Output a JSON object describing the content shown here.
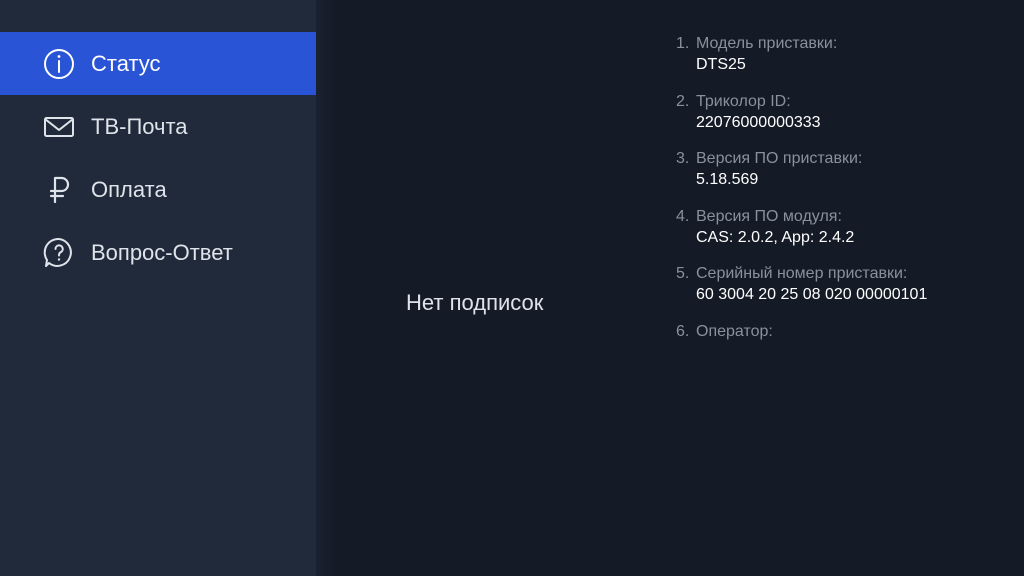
{
  "sidebar": {
    "items": [
      {
        "label": "Статус",
        "icon": "info-icon",
        "active": true
      },
      {
        "label": "ТВ-Почта",
        "icon": "mail-icon",
        "active": false
      },
      {
        "label": "Оплата",
        "icon": "ruble-icon",
        "active": false
      },
      {
        "label": "Вопрос-Ответ",
        "icon": "question-bubble-icon",
        "active": false
      }
    ]
  },
  "main": {
    "message": "Нет подписок"
  },
  "info": {
    "items": [
      {
        "num": "1.",
        "label": "Модель приставки:",
        "value": "DTS25"
      },
      {
        "num": "2.",
        "label": "Триколор ID:",
        "value": "22076000000333"
      },
      {
        "num": "3.",
        "label": "Версия ПО приставки:",
        "value": "5.18.569"
      },
      {
        "num": "4.",
        "label": "Версия ПО модуля:",
        "value": "CAS: 2.0.2, App: 2.4.2"
      },
      {
        "num": "5.",
        "label": "Серийный номер приставки:",
        "value": "60 3004 20 25 08 020 00000101"
      },
      {
        "num": "6.",
        "label": "Оператор:",
        "value": ""
      }
    ]
  },
  "colors": {
    "background": "#141a26",
    "sidebar": "#212a3b",
    "accent": "#2a54d6",
    "label_gray": "#8a919c",
    "text": "#ffffff"
  }
}
